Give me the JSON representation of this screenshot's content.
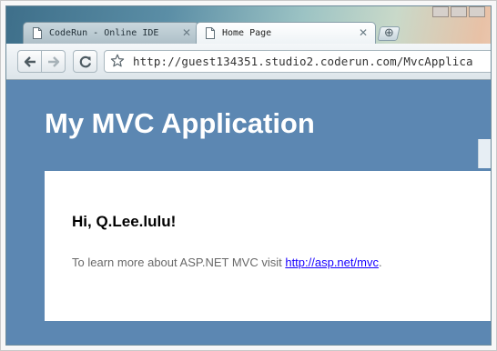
{
  "browser": {
    "tabs": [
      {
        "title": "CodeRun - Online IDE",
        "active": false
      },
      {
        "title": "Home Page",
        "active": true
      }
    ],
    "url": "http://guest134351.studio2.coderun.com/MvcApplica"
  },
  "page": {
    "app_title": "My MVC Application",
    "greeting": "Hi, Q.Lee.lulu!",
    "learn_more": {
      "prefix": "To learn more about ASP.NET MVC visit ",
      "link_text": "http://asp.net/mvc",
      "suffix": "."
    }
  },
  "colors": {
    "header_bg": "#5c87b2",
    "link": "#1800ff",
    "body_text": "#696969"
  },
  "icons": {
    "tab": "document-icon",
    "tab_close": "close-icon",
    "new_tab": "plus-icon",
    "back": "back-arrow-icon",
    "forward": "forward-arrow-icon",
    "reload": "reload-icon",
    "bookmark": "star-icon"
  }
}
